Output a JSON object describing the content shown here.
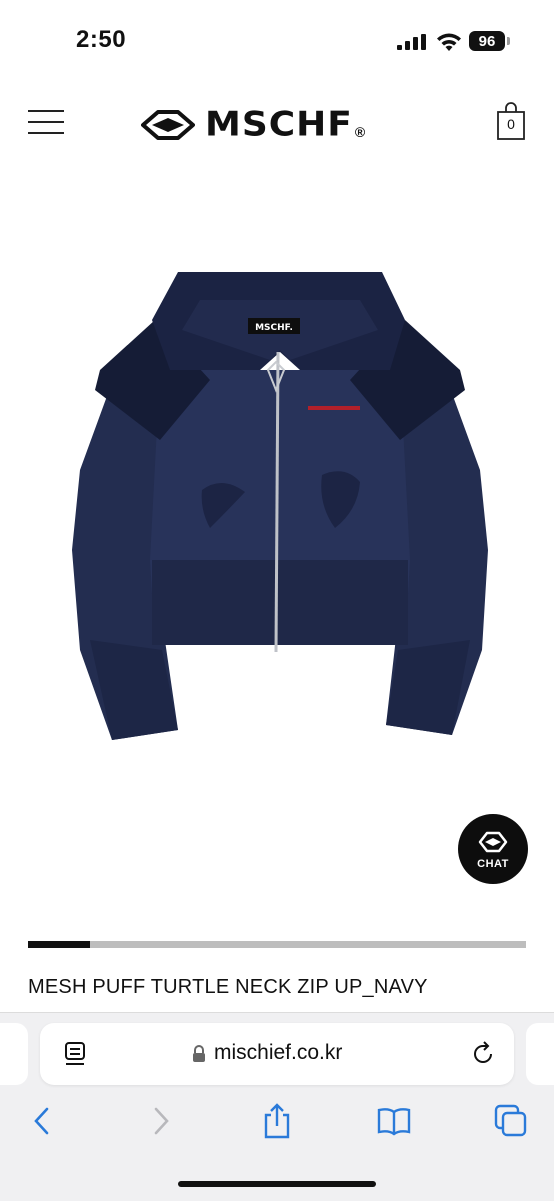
{
  "status_bar": {
    "time": "2:50",
    "battery": "96"
  },
  "header": {
    "brand": "MSCHF",
    "brand_reg": "®",
    "cart_count": "0"
  },
  "chat": {
    "label": "CHAT"
  },
  "gallery": {
    "progress": 0.125
  },
  "product": {
    "title": "MESH PUFF TURTLE NECK ZIP UP_NAVY"
  },
  "browser": {
    "url": "mischief.co.kr"
  },
  "colors": {
    "jacket": "#252f52",
    "jacket_dark": "#1a2240",
    "accent_red": "#b2202a",
    "black": "#111111"
  },
  "icons": [
    "menu-icon",
    "cart-icon",
    "chat-logo-icon",
    "reader-icon",
    "lock-icon",
    "reload-icon",
    "back-icon",
    "forward-icon",
    "share-icon",
    "bookmarks-icon",
    "tabs-icon"
  ]
}
